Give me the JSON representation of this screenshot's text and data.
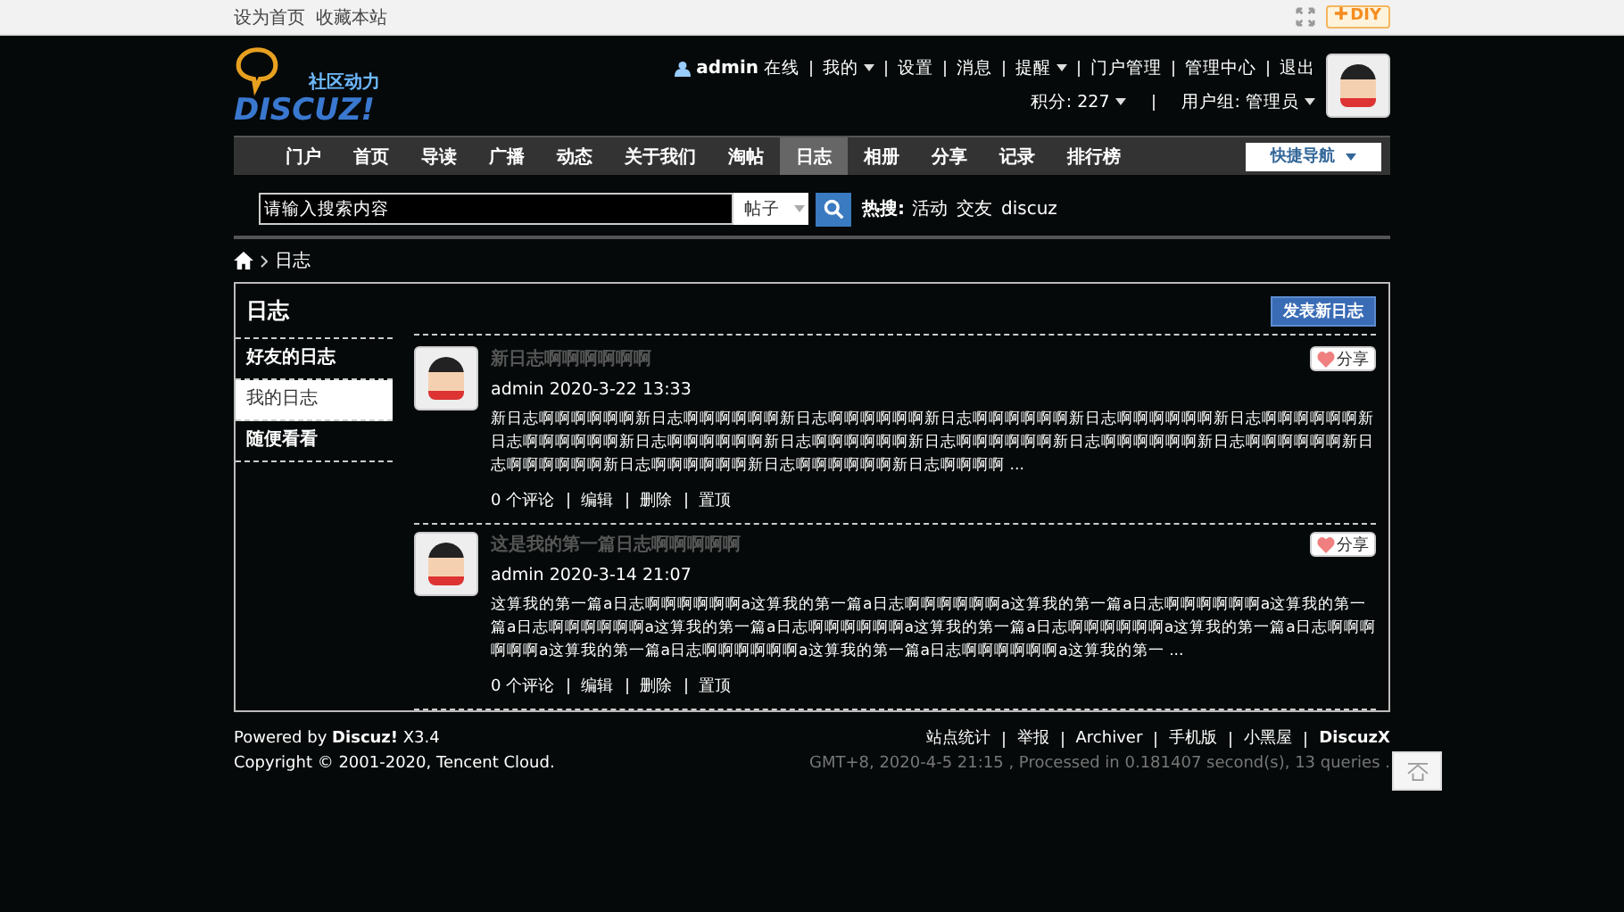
{
  "topbar": {
    "links": [
      "设为首页",
      "收藏本站"
    ],
    "diy": "DIY"
  },
  "logo": {
    "tagline": "社区动力",
    "name": "DISCUZ!"
  },
  "user": {
    "name": "admin",
    "status": "在线",
    "links": [
      {
        "label": "我的",
        "caret": true
      },
      {
        "label": "设置",
        "caret": false
      },
      {
        "label": "消息",
        "caret": false
      },
      {
        "label": "提醒",
        "caret": true
      },
      {
        "label": "门户管理",
        "caret": false
      },
      {
        "label": "管理中心",
        "caret": false
      },
      {
        "label": "退出",
        "caret": false
      }
    ],
    "stats": [
      {
        "label": "积分: 227",
        "caret": true
      },
      {
        "label": "用户组: 管理员",
        "caret": true
      }
    ]
  },
  "nav": {
    "items": [
      {
        "label": "门户",
        "selected": false
      },
      {
        "label": "首页",
        "selected": false
      },
      {
        "label": "导读",
        "selected": false
      },
      {
        "label": "广播",
        "selected": false
      },
      {
        "label": "动态",
        "selected": false
      },
      {
        "label": "关于我们",
        "selected": false
      },
      {
        "label": "淘帖",
        "selected": false
      },
      {
        "label": "日志",
        "selected": true
      },
      {
        "label": "相册",
        "selected": false
      },
      {
        "label": "分享",
        "selected": false
      },
      {
        "label": "记录",
        "selected": false
      },
      {
        "label": "排行榜",
        "selected": false
      }
    ],
    "quick_nav": "快捷导航"
  },
  "search": {
    "placeholder": "请输入搜索内容",
    "type": "帖子",
    "hot_label": "热搜:",
    "hot": [
      "活动",
      "交友",
      "discuz"
    ]
  },
  "breadcrumb": [
    "日志"
  ],
  "panel": {
    "title": "日志",
    "button": "发表新日志",
    "sidebar": [
      {
        "label": "好友的日志",
        "selected": false
      },
      {
        "label": "我的日志",
        "selected": true
      },
      {
        "label": "随便看看",
        "selected": false
      }
    ],
    "posts": [
      {
        "title": "新日志啊啊啊啊啊啊",
        "author": "admin",
        "date": "2020-3-22 13:33",
        "body": "新日志啊啊啊啊啊啊新日志啊啊啊啊啊啊新日志啊啊啊啊啊啊新日志啊啊啊啊啊啊新日志啊啊啊啊啊啊新日志啊啊啊啊啊啊新日志啊啊啊啊啊啊新日志啊啊啊啊啊啊新日志啊啊啊啊啊啊新日志啊啊啊啊啊啊新日志啊啊啊啊啊啊新日志啊啊啊啊啊啊新日志啊啊啊啊啊啊新日志啊啊啊啊啊啊新日志啊啊啊啊啊啊新日志啊啊啊啊 ...",
        "actions": [
          "0 个评论",
          "编辑",
          "删除",
          "置顶"
        ],
        "share": "分享"
      },
      {
        "title": "这是我的第一篇日志啊啊啊啊啊",
        "author": "admin",
        "date": "2020-3-14 21:07",
        "body": "这算我的第一篇a日志啊啊啊啊啊啊a这算我的第一篇a日志啊啊啊啊啊啊a这算我的第一篇a日志啊啊啊啊啊啊a这算我的第一篇a日志啊啊啊啊啊啊a这算我的第一篇a日志啊啊啊啊啊啊a这算我的第一篇a日志啊啊啊啊啊啊a这算我的第一篇a日志啊啊啊啊啊啊a这算我的第一篇a日志啊啊啊啊啊啊a这算我的第一篇a日志啊啊啊啊啊啊a这算我的第一 ...",
        "actions": [
          "0 个评论",
          "编辑",
          "删除",
          "置顶"
        ],
        "share": "分享"
      }
    ]
  },
  "footer": {
    "powered": "Powered by **Discuz!** X3.4",
    "copyright": "Copyright © 2001-2020, Tencent Cloud.",
    "links": [
      "站点统计",
      "举报",
      "Archiver",
      "手机版",
      "小黑屋",
      "DiscuzX"
    ],
    "info": "GMT+8, 2020-4-5 21:15 , Processed in 0.181407 second(s), 13 queries ."
  }
}
